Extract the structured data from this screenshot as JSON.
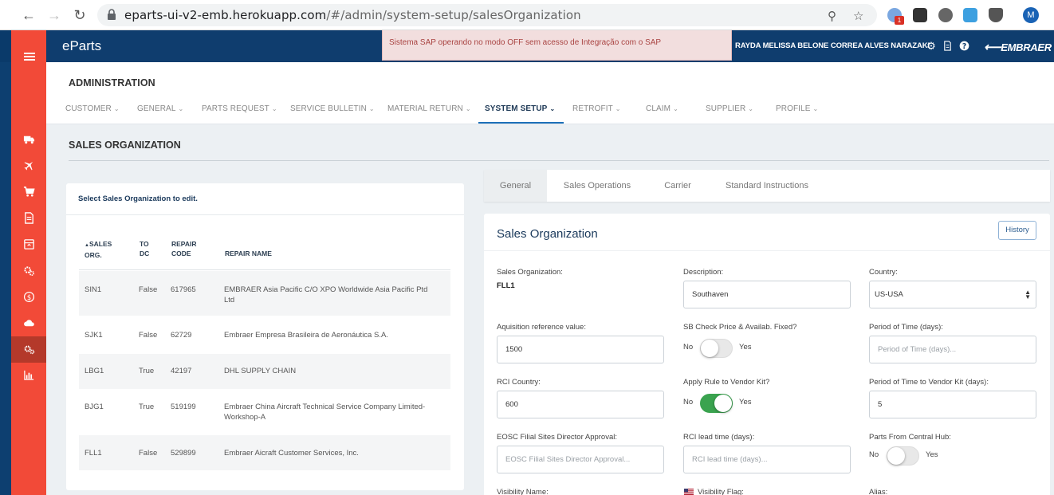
{
  "browser": {
    "url_host": "eparts-ui-v2-emb.herokuapp.com",
    "url_path": "/#/admin/system-setup/salesOrganization",
    "extension_badge": "1",
    "profile_initial": "M"
  },
  "header": {
    "brand": "eParts",
    "alert": "Sistema SAP operando no modo OFF sem acesso de Integração com o SAP",
    "user_name": "RAYDA MELISSA BELONE CORREA ALVES NARAZAKI",
    "logo": "EMBRAER"
  },
  "admin": {
    "title": "ADMINISTRATION",
    "menu": [
      {
        "label": "CUSTOMER"
      },
      {
        "label": "GENERAL"
      },
      {
        "label": "PARTS REQUEST"
      },
      {
        "label": "SERVICE BULLETIN"
      },
      {
        "label": "MATERIAL RETURN"
      },
      {
        "label": "SYSTEM SETUP"
      },
      {
        "label": "RETROFIT"
      },
      {
        "label": "CLAIM"
      },
      {
        "label": "SUPPLIER"
      },
      {
        "label": "PROFILE"
      }
    ],
    "active_menu": "SYSTEM SETUP"
  },
  "page": {
    "title": "SALES ORGANIZATION"
  },
  "list": {
    "instruction": "Select Sales Organization to edit.",
    "columns": {
      "sales_org_1": "SALES",
      "sales_org_2": "ORG.",
      "to_dc_1": "TO",
      "to_dc_2": "DC",
      "repair_code_1": "REPAIR",
      "repair_code_2": "CODE",
      "repair_name": "REPAIR NAME"
    },
    "rows": [
      {
        "org": "SIN1",
        "dc": "False",
        "code": "617965",
        "name1": "EMBRAER Asia Pacific C/O XPO Worldwide Asia Pacific Ptd",
        "name2": "Ltd"
      },
      {
        "org": "SJK1",
        "dc": "False",
        "code": "62729",
        "name1": "Embraer Empresa Brasileira de Aeronáutica S.A.",
        "name2": ""
      },
      {
        "org": "LBG1",
        "dc": "True",
        "code": "42197",
        "name1": "DHL SUPPLY CHAIN",
        "name2": ""
      },
      {
        "org": "BJG1",
        "dc": "True",
        "code": "519199",
        "name1": "Embraer China Aircraft Technical Service Company Limited-",
        "name2": "Workshop-A"
      },
      {
        "org": "FLL1",
        "dc": "False",
        "code": "529899",
        "name1": "Embraer Aicraft Customer Services, Inc.",
        "name2": ""
      }
    ]
  },
  "tabs": [
    {
      "label": "General"
    },
    {
      "label": "Sales Operations"
    },
    {
      "label": "Carrier"
    },
    {
      "label": "Standard Instructions"
    }
  ],
  "form": {
    "title": "Sales Organization",
    "history_label": "History",
    "sales_org_label": "Sales Organization:",
    "sales_org_value": "FLL1",
    "description_label": "Description:",
    "description_value": "Southaven",
    "country_label": "Country:",
    "country_value": "US-USA",
    "acq_label": "Aquisition reference value:",
    "acq_value": "1500",
    "sb_check_label": "SB Check Price & Availab. Fixed?",
    "sb_check_value": false,
    "period_label": "Period of Time (days):",
    "period_placeholder": "Period of Time (days)...",
    "rci_country_label": "RCI Country:",
    "rci_country_value": "600",
    "apply_rule_label": "Apply Rule to Vendor Kit?",
    "apply_rule_value": true,
    "period_vendor_label": "Period of Time to Vendor Kit (days):",
    "period_vendor_value": "5",
    "eosc_label": "EOSC Filial Sites Director Approval:",
    "eosc_placeholder": "EOSC Filial Sites Director Approval...",
    "rci_lead_label": "RCI lead time (days):",
    "rci_lead_placeholder": "RCI lead time (days)...",
    "central_hub_label": "Parts From Central Hub:",
    "central_hub_value": false,
    "visibility_name_label": "Visibility Name:",
    "visibility_flag_label": "Visibility Flag:",
    "alias_label": "Alias:",
    "no": "No",
    "yes": "Yes"
  },
  "colors": {
    "sidebar": "#f24a38",
    "header": "#0f3d6e",
    "accent": "#1c6fb8",
    "toggle_on": "#3aa34f"
  }
}
